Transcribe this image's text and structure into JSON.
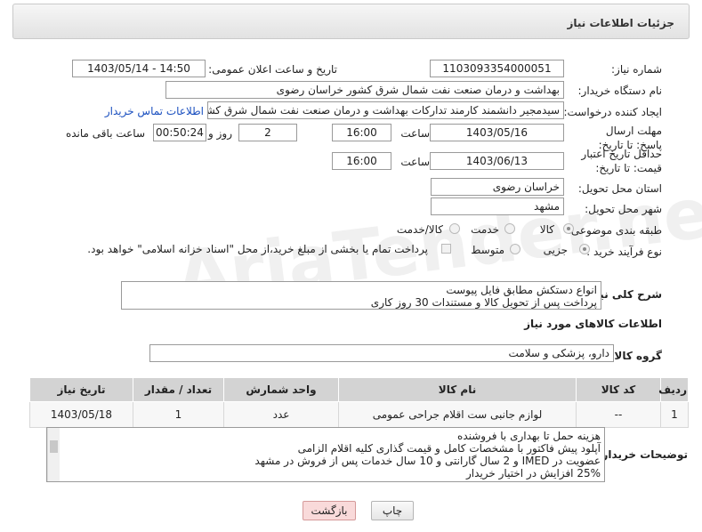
{
  "header": {
    "title": "جزئیات اطلاعات نیاز"
  },
  "fields": {
    "need_number": {
      "label": "شماره نیاز:",
      "value": "1103093354000051"
    },
    "announce_datetime": {
      "label": "تاریخ و ساعت اعلان عمومی:",
      "value": "1403/05/14 - 14:50"
    },
    "buyer_org": {
      "label": "نام دستگاه خریدار:",
      "value": "بهداشت و درمان صنعت نفت شمال شرق کشور   خراسان رضوی"
    },
    "requester": {
      "label": "ایجاد کننده درخواست:",
      "value": "سیدمجیر دانشمند کارمند تدارکات بهداشت و درمان صنعت نفت شمال شرق کشور",
      "contact_link": "اطلاعات تماس خریدار"
    },
    "reply_deadline": {
      "label": "مهلت ارسال پاسخ: تا تاریخ:",
      "date": "1403/05/16",
      "time_label": "ساعت",
      "time": "16:00",
      "days": "2",
      "days_label": "روز و",
      "remaining": "00:50:24",
      "remaining_label": "ساعت باقی مانده"
    },
    "price_validity": {
      "label": "حداقل تاریخ اعتبار قیمت: تا تاریخ:",
      "date": "1403/06/13",
      "time_label": "ساعت",
      "time": "16:00"
    },
    "delivery_province": {
      "label": "استان محل تحویل:",
      "value": "خراسان رضوی"
    },
    "delivery_city": {
      "label": "شهر محل تحویل:",
      "value": "مشهد"
    },
    "category": {
      "label": "طبقه بندی موضوعی:",
      "options": [
        "کالا",
        "خدمت",
        "کالا/خدمت"
      ],
      "selected": "کالا"
    },
    "purchase_type": {
      "label": "نوع فرآیند خرید :",
      "options": [
        "جزیی",
        "متوسط"
      ],
      "selected": "جزیی",
      "note": "پرداخت تمام یا بخشی از مبلغ خرید،از محل \"اسناد خزانه اسلامی\" خواهد بود."
    }
  },
  "general_description": {
    "label": "شرح کلی نیاز:",
    "lines": [
      "انواع دستکش مطابق فایل پیوست",
      "پرداخت پس از تحویل کالا و مستندات 30 روز کاری"
    ]
  },
  "goods_info": {
    "title": "اطلاعات کالاهای مورد نیاز",
    "group_label": "گروه کالا:",
    "group_value": "دارو، پزشکی و سلامت"
  },
  "items_table": {
    "headers": [
      "ردیف",
      "کد کالا",
      "نام کالا",
      "واحد شمارش",
      "تعداد / مقدار",
      "تاریخ نیاز"
    ],
    "rows": [
      [
        "1",
        "--",
        "لوازم جانبی ست اقلام جراحی عمومی",
        "عدد",
        "1",
        "1403/05/18"
      ]
    ]
  },
  "buyer_notes": {
    "label": "توضیحات خریدار:",
    "lines": [
      "هزینه حمل تا  بهداری  با فروشنده",
      "آپلود پیش فاکتور با مشخصات کامل  و قیمت گذاری کلیه اقلام الزامی",
      "عضویت در IMED و 2 سال گارانتی و 10 سال خدمات  پس از فروش در مشهد",
      "25% افزایش در اختیار خریدار"
    ]
  },
  "buttons": {
    "print": "چاپ",
    "back": "بازگشت"
  },
  "watermark": "AriaTender.neT",
  "colors": {
    "back_button_bg": "#f9dada",
    "link": "#1a4fbf",
    "table_header": "#d3d3d3"
  }
}
